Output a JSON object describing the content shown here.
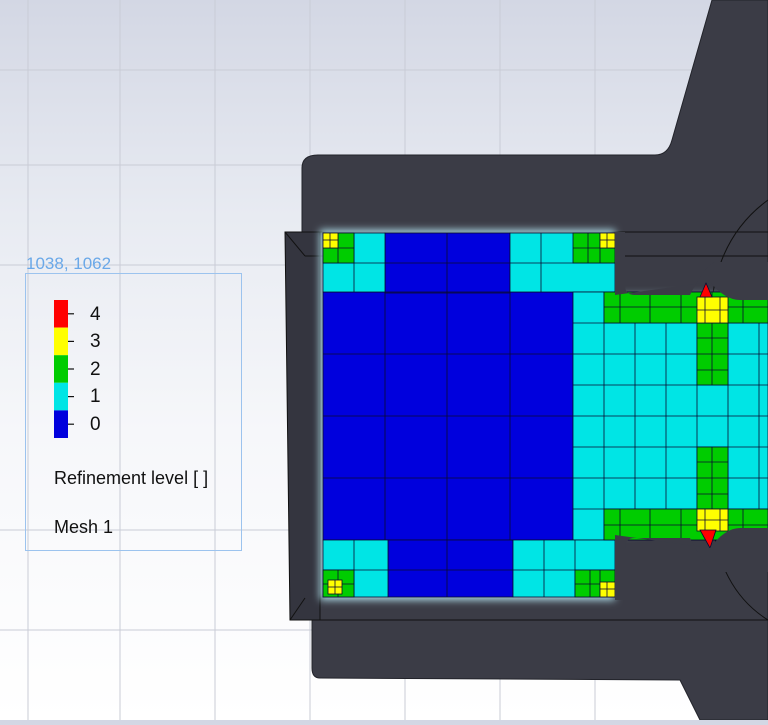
{
  "view": {
    "coordinates": "1038, 1062"
  },
  "legend": {
    "levels": [
      {
        "label": "4",
        "color": "#ff0000"
      },
      {
        "label": "3",
        "color": "#ffff00"
      },
      {
        "label": "2",
        "color": "#00cc00"
      },
      {
        "label": "1",
        "color": "#00e5e5"
      },
      {
        "label": "0",
        "color": "#0000dd"
      }
    ],
    "title": "Refinement level [ ]",
    "mesh_name": "Mesh 1"
  },
  "colors": {
    "geometry": "#3b3c46",
    "level0": "#0000dd",
    "level1": "#00e5e5",
    "level2": "#00cc00",
    "level3": "#ffff00",
    "level4": "#ff0000",
    "selection": "#9cc3ee"
  }
}
